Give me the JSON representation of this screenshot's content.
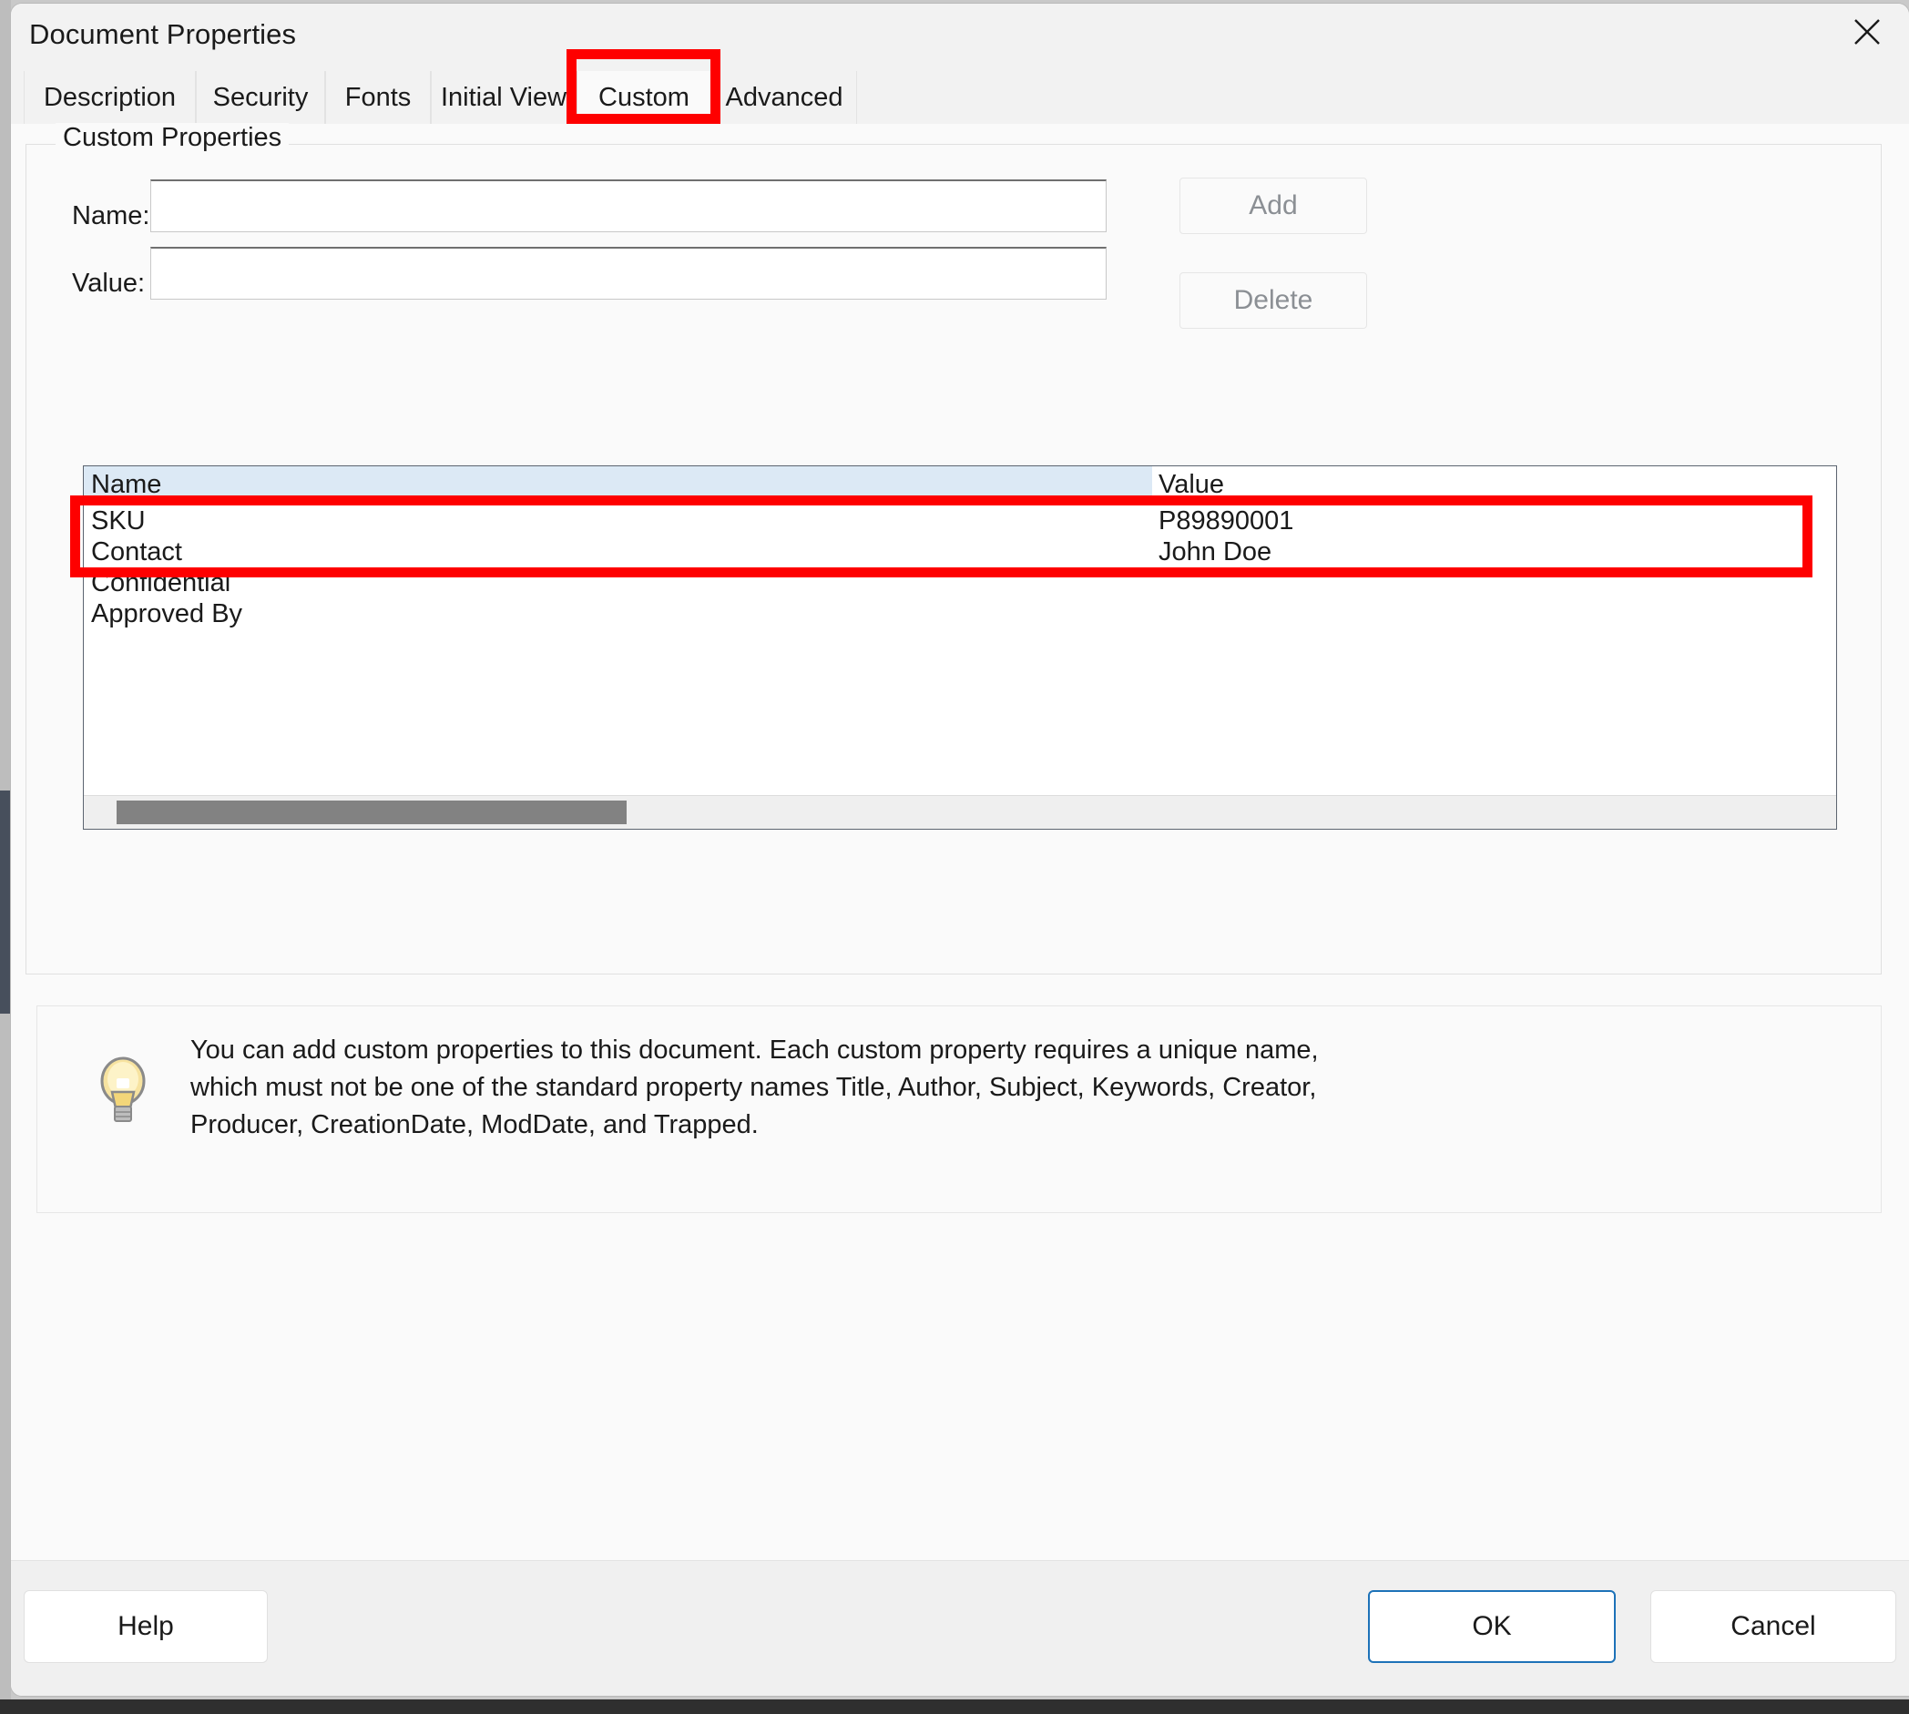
{
  "window": {
    "title": "Document Properties",
    "close_icon": "close-icon"
  },
  "tabs": [
    {
      "label": "Description",
      "active": false
    },
    {
      "label": "Security",
      "active": false
    },
    {
      "label": "Fonts",
      "active": false
    },
    {
      "label": "Initial View",
      "active": false
    },
    {
      "label": "Custom",
      "active": true
    },
    {
      "label": "Advanced",
      "active": false
    }
  ],
  "group": {
    "legend": "Custom Properties"
  },
  "form": {
    "name_label": "Name:",
    "name_value": "",
    "name_placeholder": "",
    "value_label": "Value:",
    "value_value": "",
    "value_placeholder": "",
    "add_label": "Add",
    "delete_label": "Delete"
  },
  "list": {
    "columns": [
      "Name",
      "Value"
    ],
    "rows": [
      {
        "name": "SKU",
        "value": "P89890001"
      },
      {
        "name": "Contact",
        "value": "John Doe"
      },
      {
        "name": "Confidential",
        "value": ""
      },
      {
        "name": "Approved By",
        "value": ""
      }
    ]
  },
  "hint": {
    "icon": "lightbulb-icon",
    "text": "You can add custom properties to this document. Each custom property requires a unique name, which must not be one of the standard property names Title, Author, Subject, Keywords, Creator, Producer, CreationDate, ModDate, and Trapped."
  },
  "footer": {
    "help_label": "Help",
    "ok_label": "OK",
    "cancel_label": "Cancel"
  },
  "annotations": {
    "highlight_color": "#fe0000",
    "tab_highlight": "Custom",
    "rows_highlight": "SKU / Contact rows"
  },
  "colors": {
    "header_select": "#dce9f5",
    "default_button_border": "#1d72b8",
    "scrollbar_thumb": "#828282"
  }
}
